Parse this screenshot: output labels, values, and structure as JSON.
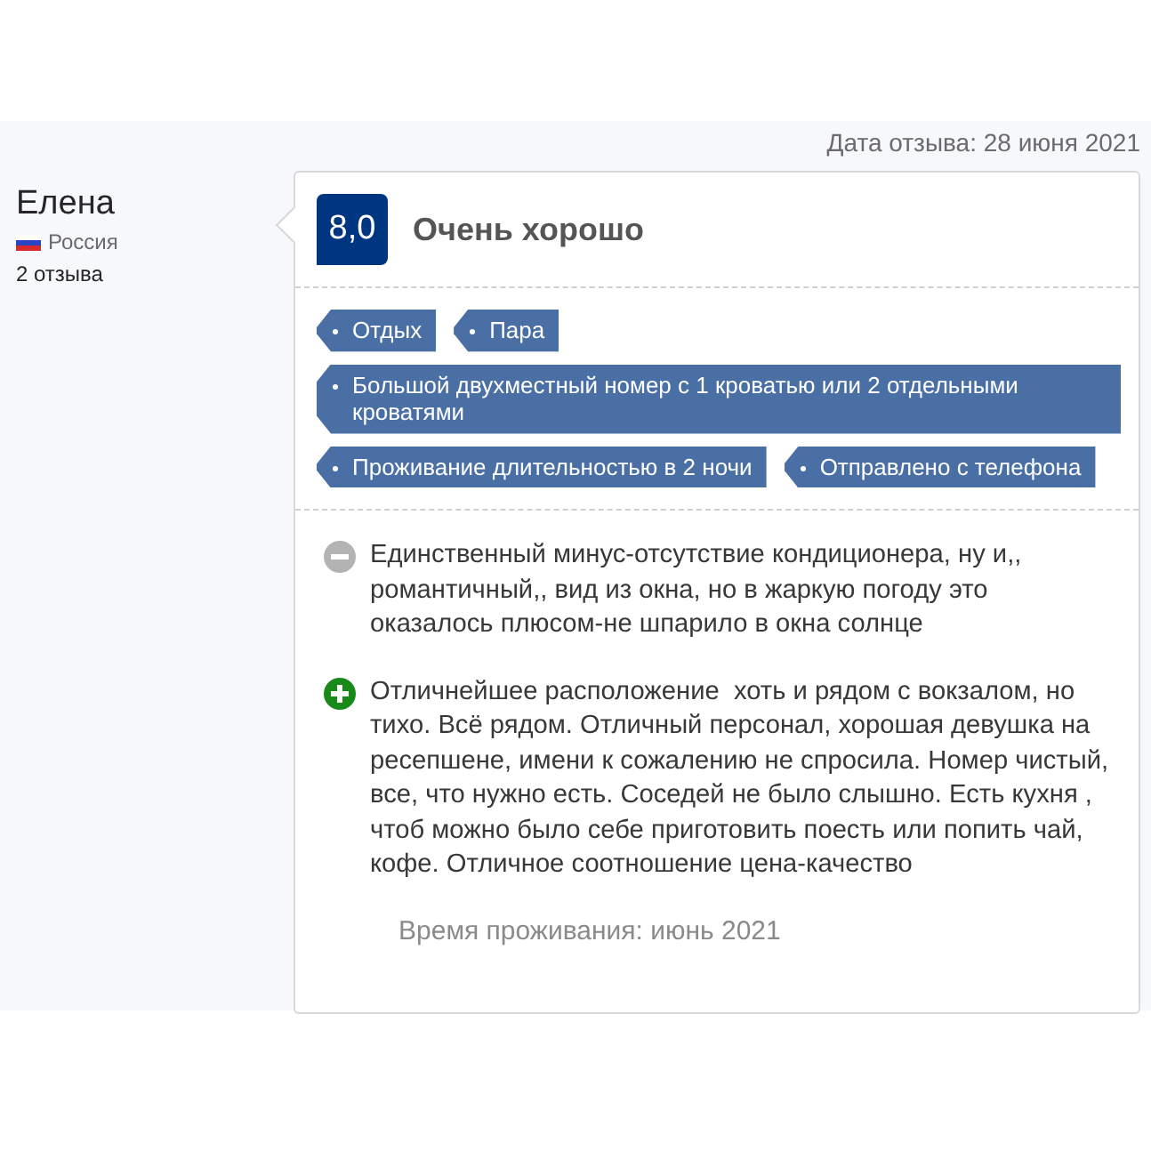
{
  "review_date": "Дата отзыва: 28 июня 2021",
  "reviewer": {
    "name": "Елена",
    "country": "Россия",
    "reviews_count": "2 отзыва"
  },
  "score": "8,0",
  "score_label": "Очень хорошо",
  "tags": [
    {
      "label": "Отдых"
    },
    {
      "label": "Пара"
    },
    {
      "label": "Большой двухместный номер с 1 кроватью или 2 отдельными кроватями"
    },
    {
      "label": "Проживание длительностью в 2 ночи"
    },
    {
      "label": "Отправлено с телефона"
    }
  ],
  "comments": [
    {
      "kind": "negative",
      "text": "Единственный минус-отсутствие кондиционера, ну и,, романтичный,, вид из окна, но в жаркую погоду это оказалось плюсом-не шпарило в окна солнце"
    },
    {
      "kind": "positive",
      "text": "Отличнейшее расположение  хоть и рядом с вокзалом, но тихо. Всё рядом. Отличный персонал, хорошая девушка на ресепшене, имени к сожалению не спросила. Номер чистый, все, что нужно есть. Соседей не было слышно. Есть кухня , чтоб можно было себе приготовить поесть или попить чай, кофе. Отличное соотношение цена-качество"
    }
  ],
  "stay_period": "Время проживания: июнь 2021"
}
